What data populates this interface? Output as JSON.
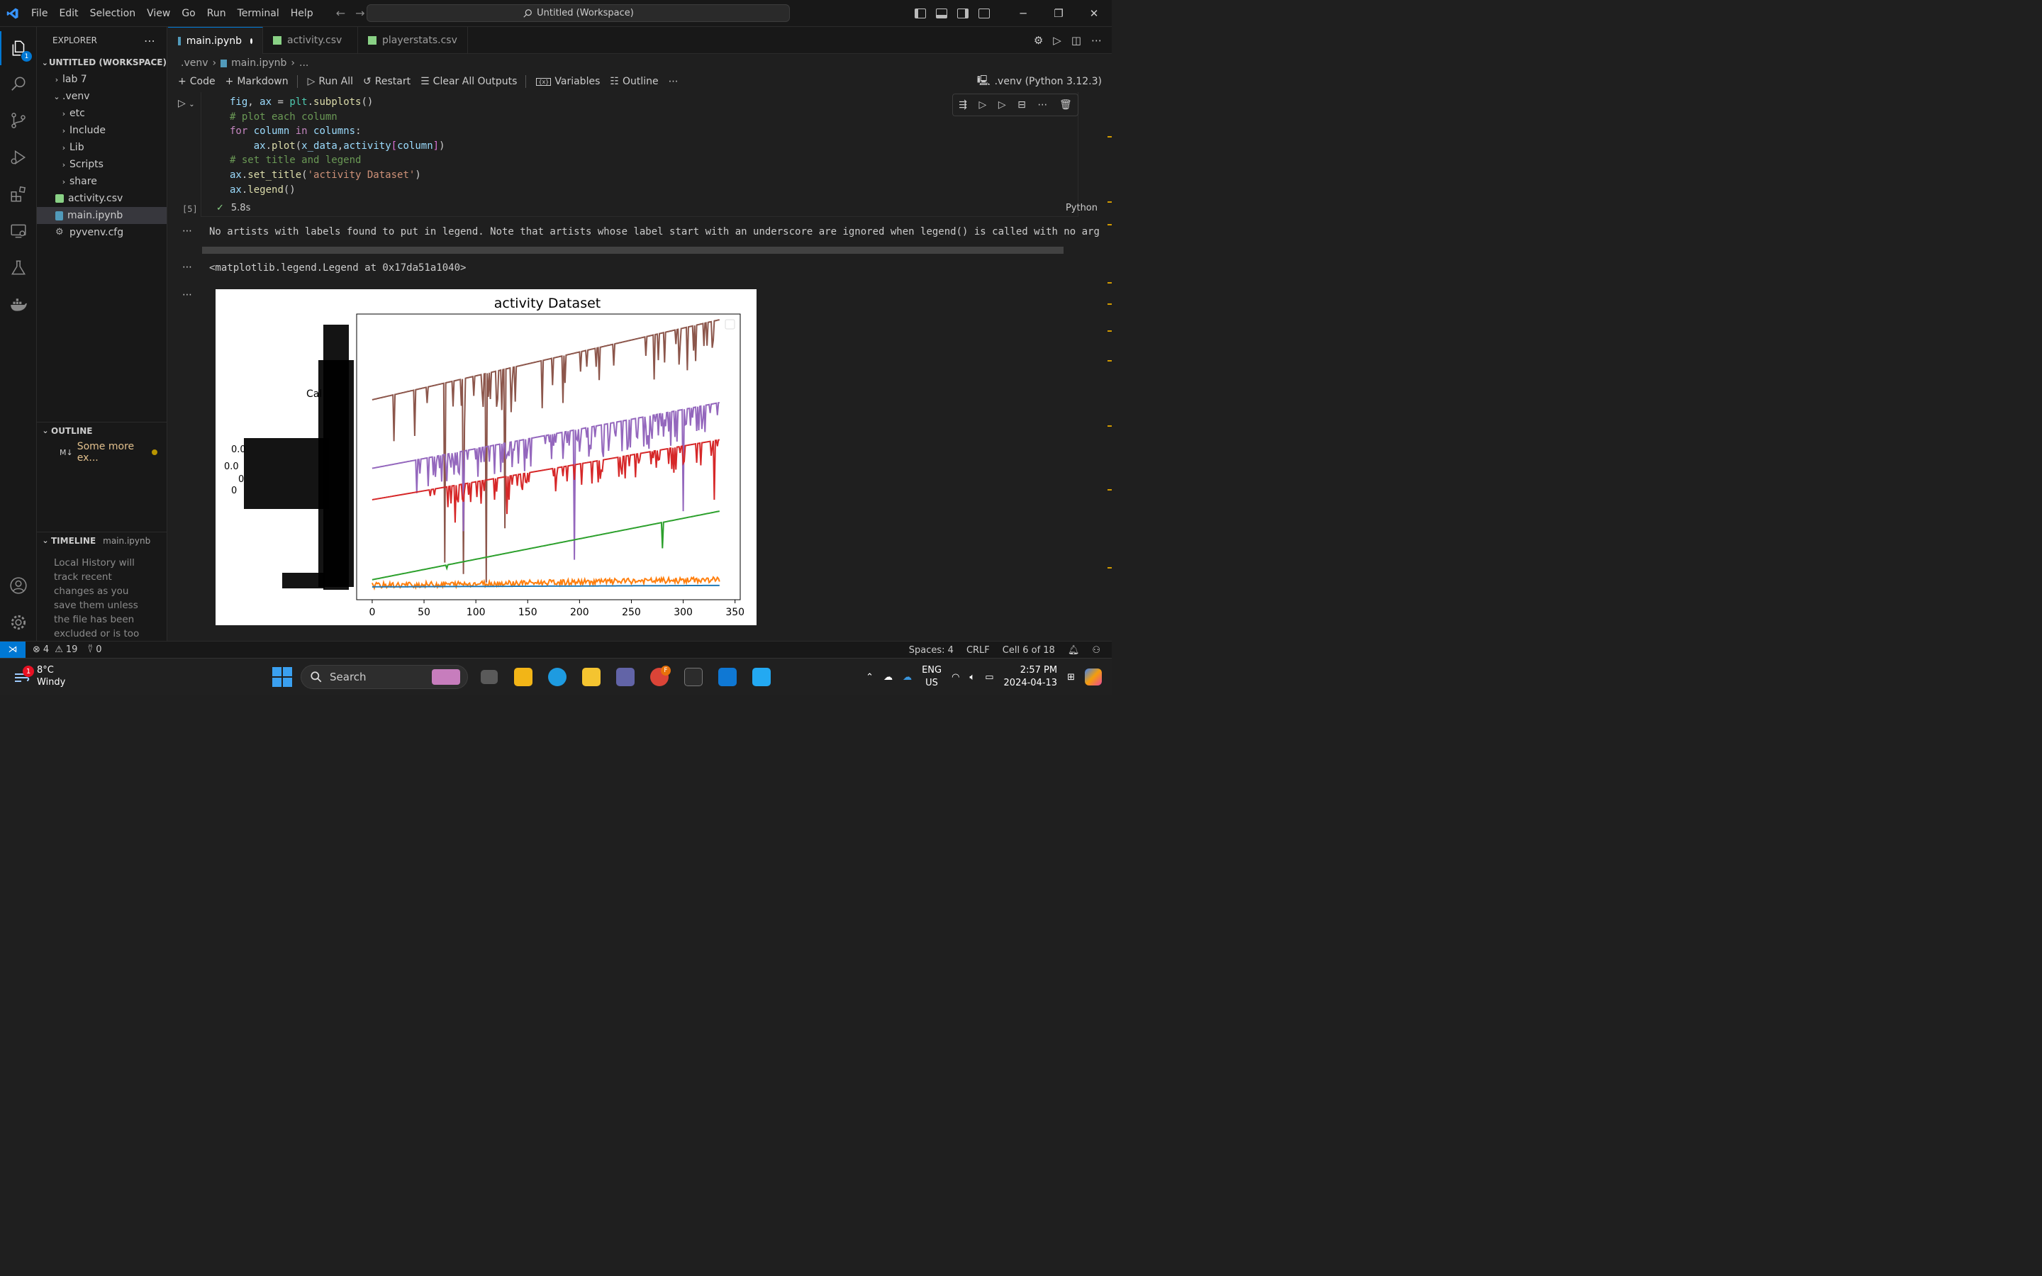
{
  "window": {
    "title": "Untitled (Workspace)",
    "menu": [
      "File",
      "Edit",
      "Selection",
      "View",
      "Go",
      "Run",
      "Terminal",
      "Help"
    ]
  },
  "activity_bar": {
    "explorer_badge": "1"
  },
  "sidebar": {
    "header": "EXPLORER",
    "workspace": "UNTITLED (WORKSPACE)",
    "items": [
      {
        "label": "lab 7",
        "kind": "folder"
      },
      {
        "label": ".venv",
        "kind": "folder-open"
      },
      {
        "label": "etc",
        "kind": "folder"
      },
      {
        "label": "Include",
        "kind": "folder"
      },
      {
        "label": "Lib",
        "kind": "folder"
      },
      {
        "label": "Scripts",
        "kind": "folder"
      },
      {
        "label": "share",
        "kind": "folder"
      },
      {
        "label": "activity.csv",
        "kind": "csv"
      },
      {
        "label": "main.ipynb",
        "kind": "notebook"
      },
      {
        "label": "pyvenv.cfg",
        "kind": "cfg"
      }
    ],
    "outline": {
      "header": "OUTLINE",
      "item_prefix": "M↓",
      "item": "Some more ex..."
    },
    "timeline": {
      "header": "TIMELINE",
      "file": "main.ipynb",
      "text": "Local History will track recent changes as you save them unless the file has been excluded or is too large. Source"
    }
  },
  "tabs": [
    {
      "label": "main.ipynb",
      "active": true,
      "dirty": true
    },
    {
      "label": "activity.csv",
      "active": false
    },
    {
      "label": "playerstats.csv",
      "active": false
    }
  ],
  "breadcrumb": {
    "folder": ".venv",
    "file": "main.ipynb",
    "more": "..."
  },
  "notebook_toolbar": {
    "code": "Code",
    "markdown": "Markdown",
    "run_all": "Run All",
    "restart": "Restart",
    "clear": "Clear All Outputs",
    "variables": "Variables",
    "outline": "Outline",
    "kernel": ".venv (Python 3.12.3)"
  },
  "cell": {
    "lines": [
      "fig, ax = plt.subplots()",
      "# plot each column",
      "for column in columns:",
      "    ax.plot(x_data,activity[column])",
      "# set title and legend",
      "ax.set_title('activity Dataset')",
      "ax.legend()"
    ],
    "execution_count": "[5]",
    "duration": "5.8s",
    "language": "Python"
  },
  "outputs": {
    "warning": "No artists with labels found to put in legend.  Note that artists whose label start with an underscore are ignored when legend() is called with no arg",
    "result": "<matplotlib.legend.Legend at 0x17da51a1040>"
  },
  "chart_data": {
    "type": "line",
    "title": "activity Dataset",
    "xlabel": "",
    "ylabel": "",
    "xlim": [
      0,
      350
    ],
    "x_ticks": [
      0,
      50,
      100,
      150,
      200,
      250,
      300,
      350
    ],
    "y_tick_labels_overlapping": true,
    "y_axis_label_fragment": "Cal",
    "y_fragment_labels": [
      "0.0",
      "0.0",
      "0",
      "0",
      "0.0"
    ],
    "legend": "empty box, top-right",
    "series": [
      {
        "color": "#8c564b",
        "trend": [
          [
            0,
            0.7
          ],
          [
            335,
            0.98
          ]
        ],
        "noise": "frequent large downward spikes",
        "dips": [
          [
            70,
            0.13
          ],
          [
            88,
            0.09
          ],
          [
            110,
            0.06
          ],
          [
            128,
            0.25
          ]
        ]
      },
      {
        "color": "#9467bd",
        "trend": [
          [
            0,
            0.46
          ],
          [
            335,
            0.69
          ]
        ],
        "noise": "dense dips",
        "dips": [
          [
            88,
            0.24
          ],
          [
            195,
            0.14
          ],
          [
            300,
            0.31
          ]
        ]
      },
      {
        "color": "#d62728",
        "trend": [
          [
            0,
            0.35
          ],
          [
            335,
            0.56
          ]
        ],
        "noise": "dips",
        "dips": [
          [
            80,
            0.27
          ],
          [
            130,
            0.3
          ],
          [
            330,
            0.35
          ]
        ]
      },
      {
        "color": "#2ca02c",
        "trend": [
          [
            0,
            0.07
          ],
          [
            335,
            0.31
          ]
        ],
        "noise": "two dips",
        "dips": [
          [
            72,
            0.11
          ],
          [
            280,
            0.18
          ]
        ]
      },
      {
        "color": "#ff7f0e",
        "trend": [
          [
            0,
            0.05
          ],
          [
            335,
            0.07
          ]
        ],
        "noise": "small wiggles"
      },
      {
        "color": "#1f77b4",
        "trend": [
          [
            0,
            0.045
          ],
          [
            335,
            0.05
          ]
        ],
        "noise": "flat"
      }
    ]
  },
  "statusbar": {
    "errors": "4",
    "warnings": "19",
    "ports": "0",
    "spaces": "Spaces: 4",
    "eol": "CRLF",
    "cell": "Cell 6 of 18"
  },
  "taskbar": {
    "temperature": "8°C",
    "condition": "Windy",
    "weather_badge": "1",
    "search": "Search",
    "chrome_badge": "F",
    "lang_top": "ENG",
    "lang_bottom": "US",
    "time": "2:57 PM",
    "date": "2024-04-13"
  }
}
